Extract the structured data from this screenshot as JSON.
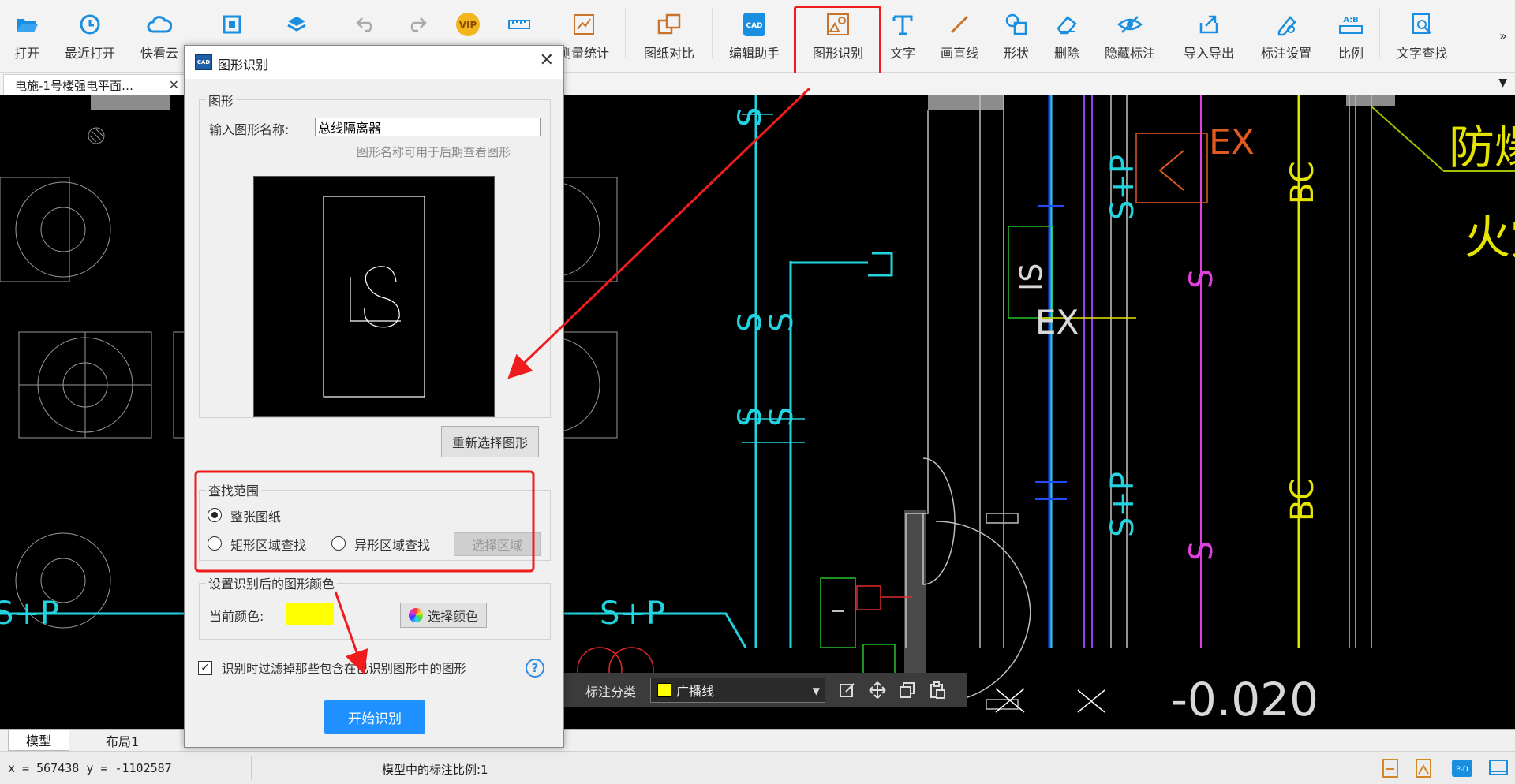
{
  "toolbar": {
    "items": [
      {
        "label": "打开",
        "icon": "folder-open-icon"
      },
      {
        "label": "最近打开",
        "icon": "history-icon"
      },
      {
        "label": "快看云",
        "icon": "cloud-icon"
      },
      {
        "label": "",
        "icon": "fit-screen-icon"
      },
      {
        "label": "",
        "icon": "layers-icon"
      },
      {
        "label": "",
        "icon": "undo-icon"
      },
      {
        "label": "",
        "icon": "redo-icon"
      },
      {
        "label": "",
        "icon": "vip-icon"
      },
      {
        "label": "",
        "icon": "measure-icon"
      },
      {
        "label": "测量统计",
        "icon": "measure-stats-icon"
      },
      {
        "label": "图纸对比",
        "icon": "compare-icon"
      },
      {
        "label": "编辑助手",
        "icon": "edit-assistant-icon"
      },
      {
        "label": "图形识别",
        "icon": "shape-recognize-icon"
      },
      {
        "label": "文字",
        "icon": "text-icon"
      },
      {
        "label": "画直线",
        "icon": "line-icon"
      },
      {
        "label": "形状",
        "icon": "shape-icon"
      },
      {
        "label": "删除",
        "icon": "eraser-icon"
      },
      {
        "label": "隐藏标注",
        "icon": "hide-annotation-icon"
      },
      {
        "label": "导入导出",
        "icon": "import-export-icon"
      },
      {
        "label": "标注设置",
        "icon": "annotation-settings-icon"
      },
      {
        "label": "比例",
        "icon": "scale-icon"
      },
      {
        "label": "文字查找",
        "icon": "text-search-icon"
      }
    ],
    "accent": "#1a8fe0",
    "highlight": "#ee1c1c"
  },
  "tab": {
    "title": "电施-1号楼强电平面…"
  },
  "cad": {
    "labels": {
      "ex": "EX",
      "s": "S",
      "sp": "S+P",
      "bc": "BC",
      "is": "IS",
      "level": "-0.020",
      "explosion": "防爆型",
      "fire": "火灾"
    }
  },
  "dialog": {
    "title": "图形识别",
    "shape_group": "图形",
    "name_label": "输入图形名称:",
    "name_value": "总线隔离器",
    "name_hint": "图形名称可用于后期查看图形",
    "reselect": "重新选择图形",
    "scope_group": "查找范围",
    "scope_options": [
      {
        "label": "整张图纸",
        "selected": true
      },
      {
        "label": "矩形区域查找",
        "selected": false
      },
      {
        "label": "异形区域查找",
        "selected": false
      }
    ],
    "select_area": "选择区域",
    "color_group": "设置识别后的图形颜色",
    "current_color_label": "当前颜色:",
    "current_color": "#ffff00",
    "choose_color": "选择颜色",
    "filter_label": "识别时过滤掉那些包含在已识别图形中的图形",
    "filter_checked": true,
    "start": "开始识别",
    "help": "?"
  },
  "annotation_bar": {
    "label": "标注分类",
    "category": "广播线",
    "category_color": "#ffff00"
  },
  "layout_tabs": [
    {
      "label": "模型",
      "active": true
    },
    {
      "label": "布局1",
      "active": false
    }
  ],
  "status": {
    "coords": "x = 567438  y = -1102587",
    "scale": "模型中的标注比例:1"
  }
}
